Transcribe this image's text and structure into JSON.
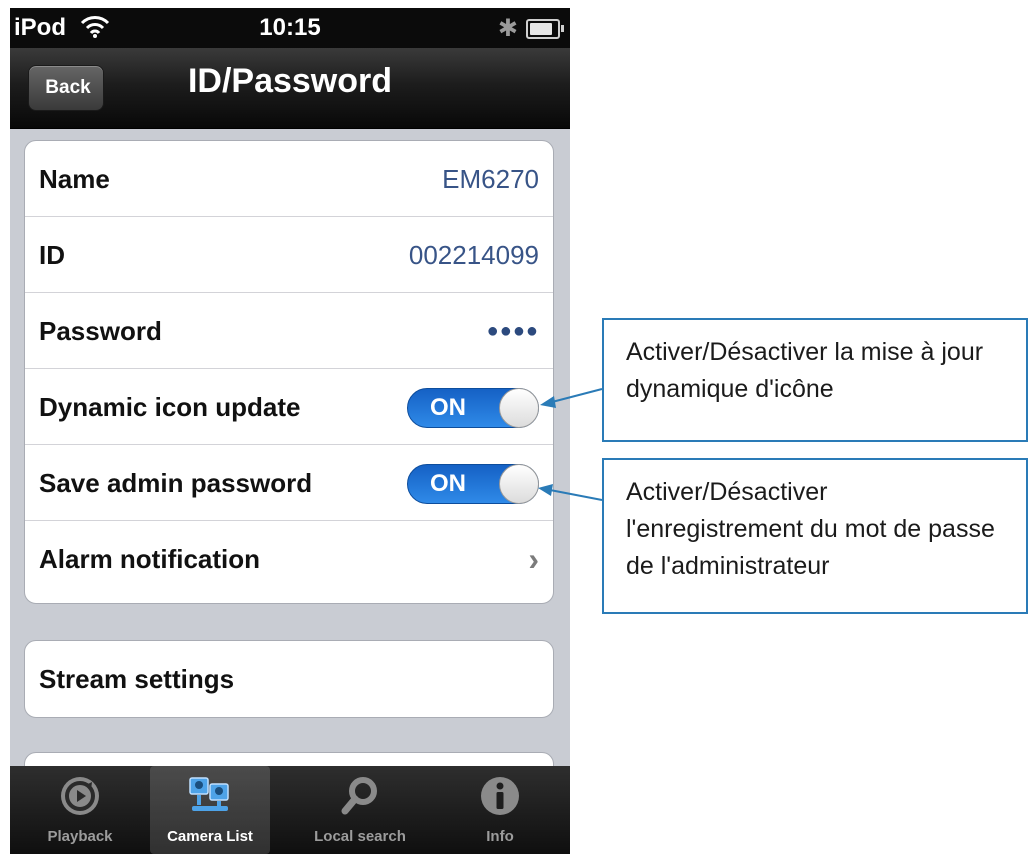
{
  "status_bar": {
    "carrier": "iPod",
    "time": "10:15",
    "battery_level": 0.85
  },
  "nav": {
    "back_label": "Back",
    "title": "ID/Password"
  },
  "rows": {
    "name": {
      "label": "Name",
      "value": "EM6270"
    },
    "id": {
      "label": "ID",
      "value": "002214099"
    },
    "password": {
      "label": "Password",
      "value": "●●●●"
    },
    "dynamic_icon": {
      "label": "Dynamic icon update",
      "state": "ON"
    },
    "save_admin": {
      "label": "Save admin password",
      "state": "ON"
    },
    "alarm": {
      "label": "Alarm notification",
      "chevron": "›"
    }
  },
  "stream": {
    "label": "Stream settings"
  },
  "tabbar": {
    "active": "Camera List",
    "tabs": [
      {
        "label": "Playback",
        "icon": "playback-icon"
      },
      {
        "label": "Camera List",
        "icon": "camera-list-icon"
      },
      {
        "label": "Local search",
        "icon": "search-icon"
      },
      {
        "label": "Info",
        "icon": "info-icon"
      }
    ]
  },
  "callouts": {
    "dynamic_icon": "Activer/Désactiver la mise à jour dynamique d'icône",
    "save_admin": "Activer/Désactiver l'enregistrement du mot de passe de l'administrateur"
  },
  "colors": {
    "toggle_on": "#1f74d6",
    "value_text": "#385487",
    "callout_border": "#2a7bb7",
    "nav_bar": "#121212"
  }
}
